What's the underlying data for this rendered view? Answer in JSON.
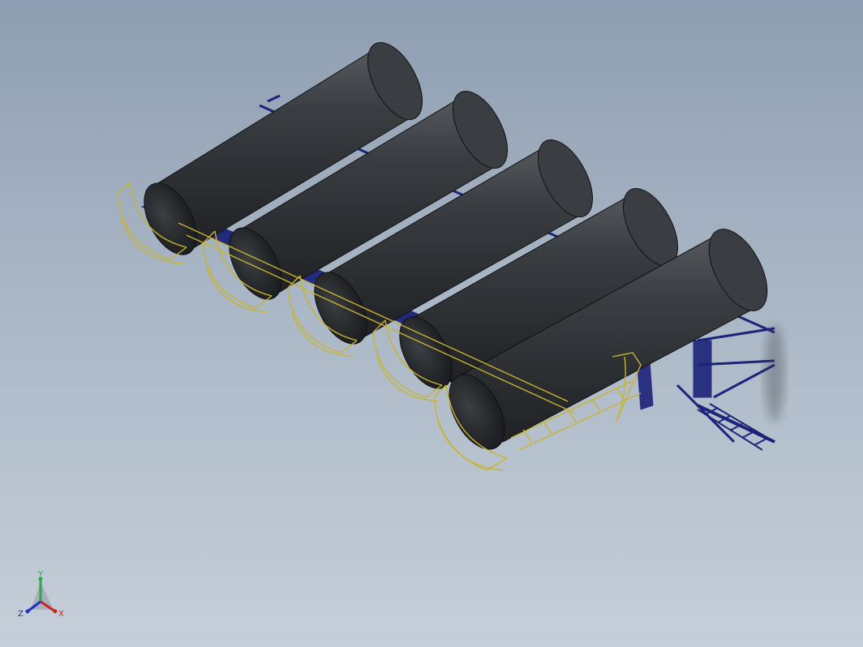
{
  "viewport": {
    "background_top": "#8e9db1",
    "background_bottom": "#c6cfd9"
  },
  "model": {
    "tank_count": 5,
    "tank_color": "#2f3236",
    "tank_highlight": "#5a5e63",
    "frame_color": "#1c2378",
    "cage_color": "#c8b430"
  },
  "triad": {
    "y_label": "Y",
    "x_label": "X",
    "z_label": "Z",
    "y_color": "#2aa84a",
    "x_color": "#d02020",
    "z_color": "#2030c0"
  }
}
